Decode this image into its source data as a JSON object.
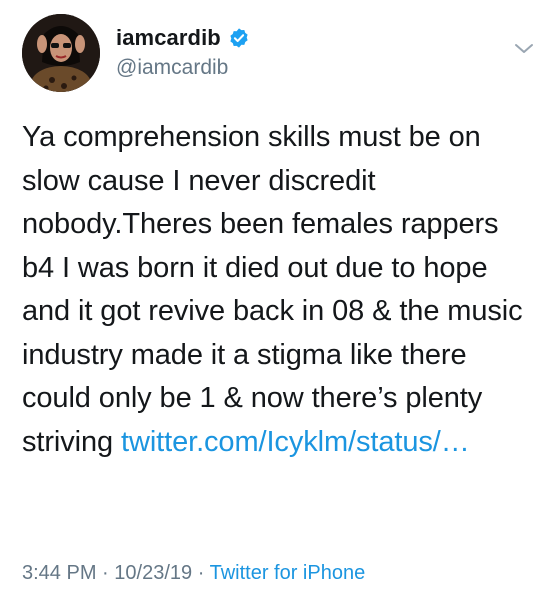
{
  "tweet": {
    "display_name": "iamcardib",
    "handle": "@iamcardib",
    "text": "Ya comprehension skills must be on slow cause I never discredit nobody.Theres been females rappers b4 I was born it died out due to hope and it got revive back in 08 & the music industry made it a stigma like there could only be 1 & now there’s plenty striving",
    "link_text": "twitter.com/Icyklm/status/…",
    "time": "3:44 PM",
    "date": "10/23/19",
    "separator": "·",
    "source": "Twitter for iPhone"
  },
  "icons": {
    "verified": "verified-badge-icon",
    "menu": "chevron-down-icon"
  },
  "colors": {
    "text": "#14171a",
    "secondary": "#657786",
    "link": "#1b95e0",
    "verified": "#1da1f2"
  }
}
